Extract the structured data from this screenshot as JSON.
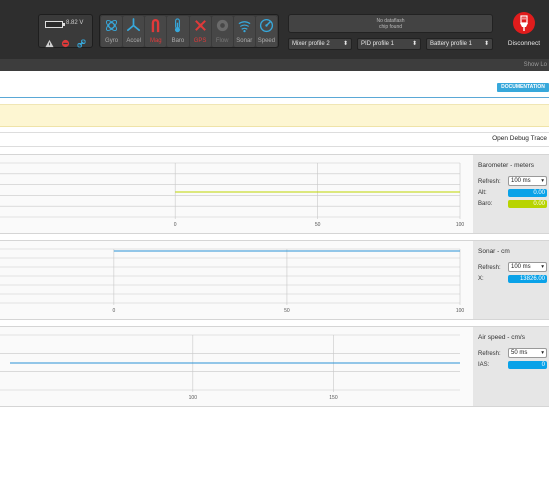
{
  "topbar": {
    "voltage": "8.82 V",
    "sensors": [
      {
        "label": "Gyro",
        "icon": "gyro-icon",
        "state": "ok"
      },
      {
        "label": "Accel",
        "icon": "accel-icon",
        "state": "ok"
      },
      {
        "label": "Mag",
        "icon": "mag-icon",
        "state": "error"
      },
      {
        "label": "Baro",
        "icon": "baro-icon",
        "state": "ok"
      },
      {
        "label": "GPS",
        "icon": "gps-icon",
        "state": "error"
      },
      {
        "label": "Flow",
        "icon": "flow-icon",
        "state": "off"
      },
      {
        "label": "Sonar",
        "icon": "sonar-icon",
        "state": "ok"
      },
      {
        "label": "Speed",
        "icon": "speed-icon",
        "state": "ok"
      }
    ],
    "dataflash_line1": "No dataflash",
    "dataflash_line2": "chip found",
    "mixer_profile": "Mixer profile 2",
    "pid_profile": "PID profile 1",
    "battery_profile": "Battery profile 1",
    "disconnect_label": "Disconnect",
    "show_log": "Show Lo"
  },
  "toolbar": {
    "documentation_label": "DOCUMENTATION",
    "open_debug_trace": "Open Debug Trace"
  },
  "colors": {
    "ok": "#37a8db",
    "error": "#e03a3a",
    "baro": "#bdd500",
    "blue": "#2a93d5",
    "topbar": "#2e2e2e"
  },
  "graphs": [
    {
      "title": "Barometer - meters",
      "refresh_label": "Refresh:",
      "refresh_value": "100 ms",
      "readouts": [
        {
          "label": "Alt:",
          "value": "0.00",
          "color": "#0aa2e8"
        },
        {
          "label": "Baro:",
          "value": "0.00",
          "color": "#b8d400"
        }
      ]
    },
    {
      "title": "Sonar - cm",
      "refresh_label": "Refresh:",
      "refresh_value": "100 ms",
      "readouts": [
        {
          "label": "X:",
          "value": "13826.00",
          "color": "#0aa2e8"
        }
      ]
    },
    {
      "title": "Air speed - cm/s",
      "refresh_label": "Refresh:",
      "refresh_value": "50 ms",
      "readouts": [
        {
          "label": "IAS:",
          "value": "0",
          "color": "#0aa2e8"
        }
      ]
    }
  ],
  "chart_data": [
    {
      "type": "line",
      "title": "Barometer - meters",
      "xlim": [
        -58,
        100
      ],
      "x_ticks": [
        0,
        50,
        100
      ],
      "grid": true,
      "series": [
        {
          "name": "Baro",
          "x": [
            0,
            100
          ],
          "y": [
            0,
            0
          ],
          "color": "#bdd500"
        }
      ]
    },
    {
      "type": "line",
      "title": "Sonar - cm",
      "xlim": [
        -30,
        100
      ],
      "x_ticks": [
        0,
        50,
        100
      ],
      "grid": true,
      "series": [
        {
          "name": "X",
          "x": [
            0,
            100
          ],
          "y": [
            13826,
            13826
          ],
          "color": "#2a93d5"
        }
      ]
    },
    {
      "type": "line",
      "title": "Air speed - cm/s",
      "xlim": [
        35,
        195
      ],
      "x_ticks": [
        100,
        150
      ],
      "grid": true,
      "series": [
        {
          "name": "IAS",
          "x": [
            35,
            195
          ],
          "y": [
            0,
            0
          ],
          "color": "#2a93d5"
        }
      ]
    }
  ]
}
